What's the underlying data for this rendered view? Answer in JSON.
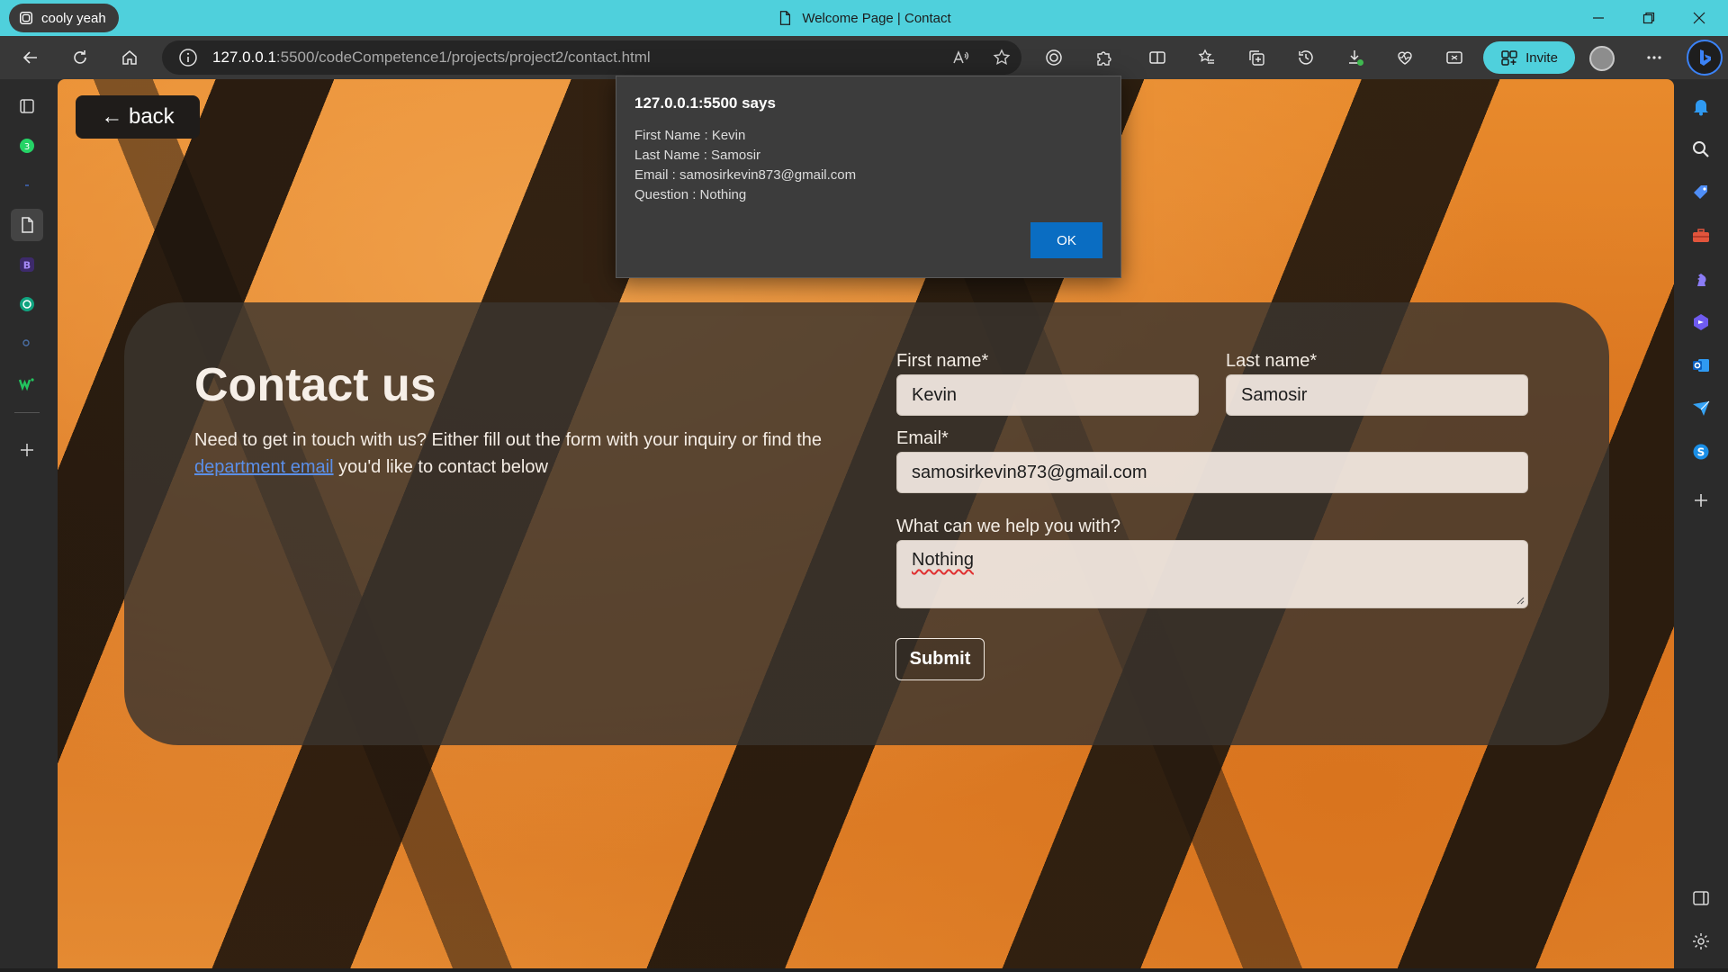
{
  "titlebar": {
    "profile_name": "cooly yeah",
    "tab_title": "Welcome Page | Contact"
  },
  "toolbar": {
    "url_host": "127.0.0.1",
    "url_rest": ":5500/codeCompetence1/projects/project2/contact.html",
    "invite_label": "Invite"
  },
  "page": {
    "back_label": "← back",
    "title": "Contact us",
    "desc_before": "Need to get in touch with us? Either fill out the form with your inquiry or find the ",
    "desc_link": "department email",
    "desc_after": " you'd like to contact below",
    "form": {
      "first_name_label": "First name*",
      "first_name_value": "Kevin",
      "last_name_label": "Last name*",
      "last_name_value": "Samosir",
      "email_label": "Email*",
      "email_value": "samosirkevin873@gmail.com",
      "question_label": "What can we help you with?",
      "question_value": "Nothing",
      "submit_label": "Submit"
    }
  },
  "alert": {
    "title": "127.0.0.1:5500 says",
    "lines": [
      "First Name : Kevin",
      "Last Name : Samosir",
      "Email : samosirkevin873@gmail.com",
      "Question : Nothing"
    ],
    "ok_label": "OK"
  },
  "colors": {
    "titlebar": "#4fd0dc",
    "toolbar": "#383838",
    "alert_ok": "#0a6dc2",
    "link": "#5b8fe8"
  }
}
